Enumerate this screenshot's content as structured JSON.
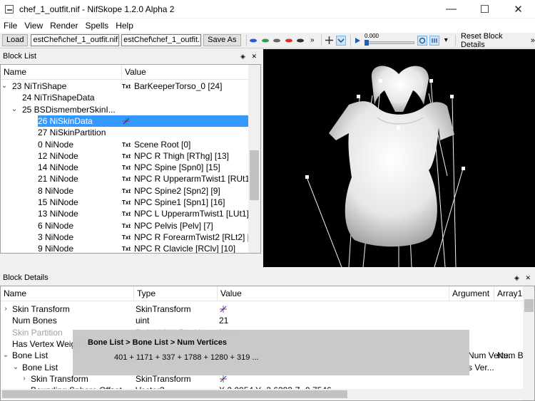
{
  "window": {
    "title": "chef_1_outfit.nif - NifSkope 1.2.0 Alpha 2",
    "minimize": "—",
    "maximize": "☐",
    "close": "✕"
  },
  "menu": [
    "File",
    "View",
    "Render",
    "Spells",
    "Help"
  ],
  "toolbar": {
    "load": "Load",
    "path1": "estChef\\chef_1_outfit.nif",
    "path2": "estChef\\chef_1_outfit.nif",
    "save_as": "Save As",
    "zero": "0.000",
    "reset": "Reset Block Details",
    "more": "»",
    "small_more": "»"
  },
  "block_list": {
    "title": "Block List",
    "dock_btns": "◈ ✕",
    "col_name": "Value",
    "col_name_label": "Name",
    "rows": [
      {
        "arrow": "v",
        "name": "23 NiTriShape",
        "txt": "Txt",
        "value": "BarKeeperTorso_0 [24]"
      },
      {
        "arrow": "",
        "name": "24 NiTriShapeData",
        "txt": "",
        "value": ""
      },
      {
        "arrow": "v",
        "name": "25 BSDismemberSkinI...",
        "txt": "",
        "value": ""
      },
      {
        "arrow": "",
        "name": "26 NiSkinData",
        "txt": "",
        "value": ""
      },
      {
        "arrow": "",
        "name": "27 NiSkinPartition",
        "txt": "",
        "value": ""
      },
      {
        "arrow": "",
        "name": "0 NiNode",
        "txt": "Txt",
        "value": "Scene Root [0]"
      },
      {
        "arrow": "",
        "name": "12 NiNode",
        "txt": "Txt",
        "value": "NPC R Thigh [RThg] [13]"
      },
      {
        "arrow": "",
        "name": "14 NiNode",
        "txt": "Txt",
        "value": "NPC Spine [Spn0] [15]"
      },
      {
        "arrow": "",
        "name": "21 NiNode",
        "txt": "Txt",
        "value": "NPC R UpperarmTwist1 [RUt1]"
      },
      {
        "arrow": "",
        "name": "8 NiNode",
        "txt": "Txt",
        "value": "NPC Spine2 [Spn2] [9]"
      },
      {
        "arrow": "",
        "name": "15 NiNode",
        "txt": "Txt",
        "value": "NPC Spine1 [Spn1] [16]"
      },
      {
        "arrow": "",
        "name": "13 NiNode",
        "txt": "Txt",
        "value": "NPC L UpperarmTwist1 [LUt1]"
      },
      {
        "arrow": "",
        "name": "6 NiNode",
        "txt": "Txt",
        "value": "NPC Pelvis [Pelv] [7]"
      },
      {
        "arrow": "",
        "name": "3 NiNode",
        "txt": "Txt",
        "value": "NPC R ForearmTwist2 [RLt2] [4"
      },
      {
        "arrow": "",
        "name": "9 NiNode",
        "txt": "Txt",
        "value": "NPC R Clavicle [RClv] [10]"
      }
    ]
  },
  "block_details": {
    "title": "Block Details",
    "dock_btns": "◈ ✕",
    "cols": {
      "name": "Name",
      "type": "Type",
      "value": "Value",
      "argument": "Argument",
      "array1": "Array1"
    },
    "rows": [
      {
        "arrow": ">",
        "name": "Skin Transform",
        "type": "SkinTransform",
        "value": "",
        "gray": false
      },
      {
        "arrow": "",
        "name": "Num Bones",
        "type": "uint",
        "value": "21",
        "gray": false
      },
      {
        "arrow": "",
        "name": "Skin Partition",
        "type": "Ref<NiSkinPartition>",
        "value": "None",
        "gray": true
      },
      {
        "arrow": "",
        "name": "Has Vertex Weights",
        "type": "byte",
        "value": "",
        "gray": false
      },
      {
        "arrow": "v",
        "name": "Bone List",
        "type": "",
        "value": "",
        "arg": "Num Verte...",
        "arr": "Num B"
      },
      {
        "arrow": "v",
        "name": "Bone List",
        "type": "",
        "value": "",
        "arg": "s Ver...",
        "arr": ""
      },
      {
        "arrow": ">",
        "name": "Skin Transform",
        "type": "SkinTransform",
        "value": "",
        "gray": false
      },
      {
        "arrow": "",
        "name": "Bounding Sphere Offset",
        "type": "Vector3",
        "value": "X 2.0954 Y -2.6393 Z -9.7546",
        "gray": false
      }
    ]
  },
  "tooltip": {
    "title": "Bone List > Bone List > Num Vertices",
    "line": "401 + 1171 + 337 + 1788 + 1280 + 319 ..."
  }
}
